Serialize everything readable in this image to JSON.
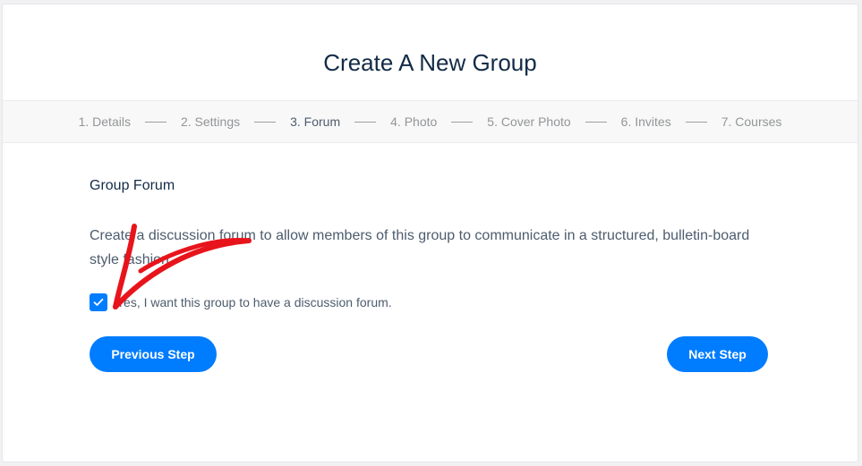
{
  "page": {
    "title": "Create A New Group"
  },
  "steps": [
    {
      "label": "1. Details"
    },
    {
      "label": "2. Settings"
    },
    {
      "label": "3. Forum"
    },
    {
      "label": "4. Photo"
    },
    {
      "label": "5. Cover Photo"
    },
    {
      "label": "6. Invites"
    },
    {
      "label": "7. Courses"
    }
  ],
  "current_step": "3. Forum",
  "forum": {
    "section_title": "Group Forum",
    "description": "Create a discussion forum to allow members of this group to communicate in a structured, bulletin-board style fashion.",
    "checkbox_label": "Yes, I want this group to have a discussion forum.",
    "checkbox_checked": true
  },
  "buttons": {
    "previous": "Previous Step",
    "next": "Next Step"
  },
  "colors": {
    "accent": "#007cff",
    "annotation": "#e8141c"
  },
  "annotation": {
    "icon": "red-arrow-annotation"
  }
}
